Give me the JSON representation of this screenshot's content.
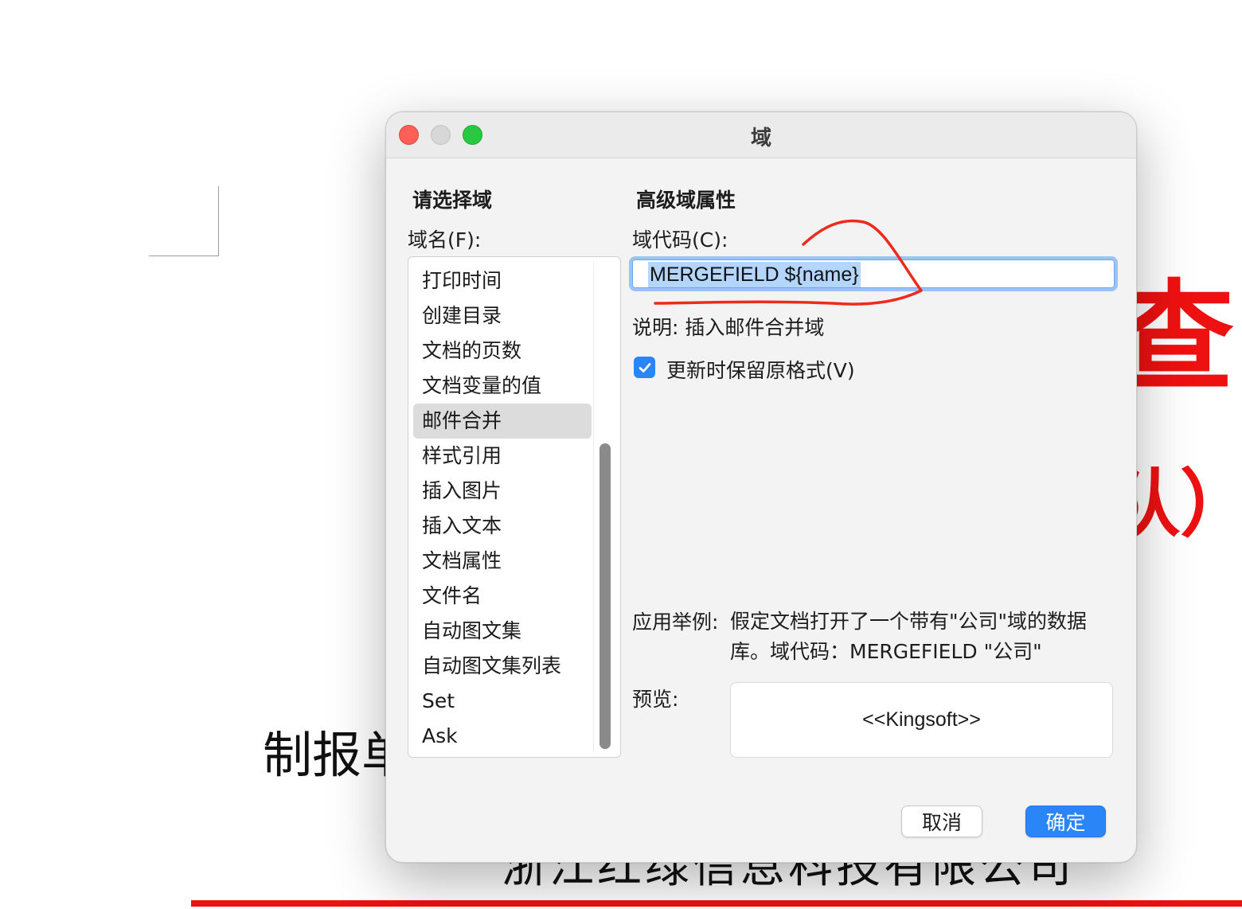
{
  "document": {
    "red_heading_fragment": "查",
    "red_subheading_fragment": "队）",
    "text_line_1": "制报单",
    "text_line_2": "浙江红绿信息科技有限公司",
    "colors": {
      "heading_red": "#ee1111"
    }
  },
  "dialog": {
    "title": "域",
    "left_heading": "请选择域",
    "right_heading": "高级域属性",
    "field_name_label": "域名(F):",
    "field_code_label": "域代码(C):",
    "field_code_value": "MERGEFIELD ${name}",
    "description": "说明: 插入邮件合并域",
    "preserve_format": {
      "label": "更新时保留原格式(V)",
      "checked": true
    },
    "example_label": "应用举例:",
    "example_text": "假定文档打开了一个带有\"公司\"域的数据库。域代码：MERGEFIELD \"公司\"",
    "preview_label": "预览:",
    "preview_value": "<<Kingsoft>>",
    "fields": [
      "打印时间",
      "创建目录",
      "文档的页数",
      "文档变量的值",
      "邮件合并",
      "样式引用",
      "插入图片",
      "插入文本",
      "文档属性",
      "文件名",
      "自动图文集",
      "自动图文集列表",
      "Set",
      "Ask"
    ],
    "selected_field": "邮件合并",
    "buttons": {
      "cancel": "取消",
      "ok": "确定"
    },
    "colors": {
      "accent": "#2a86f6",
      "annotation": "#ee2a1a"
    }
  }
}
